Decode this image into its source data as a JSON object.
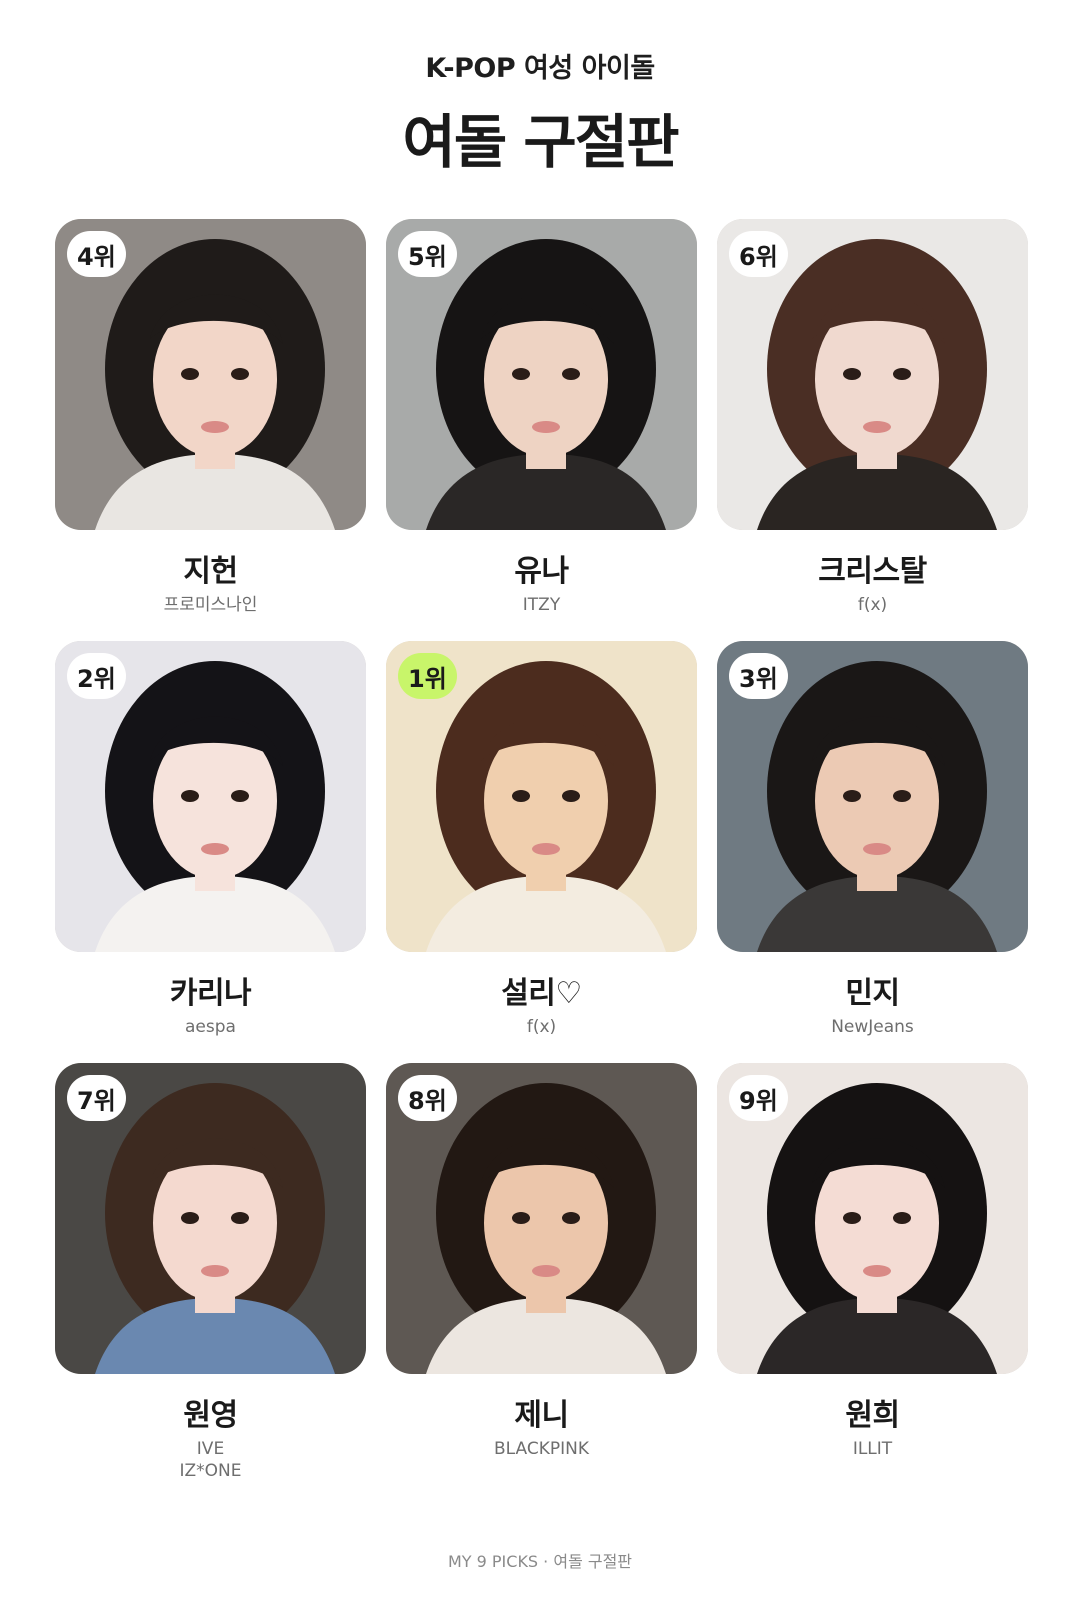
{
  "header": {
    "subtitle": "K-POP 여성 아이돌",
    "title": "여돌 구절판"
  },
  "cards": [
    {
      "rank_label": "4위",
      "name": "지헌",
      "group": "프로미스나인",
      "group_2": "",
      "highlight": false,
      "photo": {
        "bg": "#8f8a86",
        "hair": "#1f1b19",
        "skin": "#f2d6c8",
        "cloth": "#e9e6e2"
      }
    },
    {
      "rank_label": "5위",
      "name": "유나",
      "group": "ITZY",
      "group_2": "",
      "highlight": false,
      "photo": {
        "bg": "#a8aaa9",
        "hair": "#161414",
        "skin": "#eed3c3",
        "cloth": "#2a2726"
      }
    },
    {
      "rank_label": "6위",
      "name": "크리스탈",
      "group": "f(x)",
      "group_2": "",
      "highlight": false,
      "photo": {
        "bg": "#eae8e6",
        "hair": "#4a2e24",
        "skin": "#f0d9cf",
        "cloth": "#2a2522"
      }
    },
    {
      "rank_label": "2위",
      "name": "카리나",
      "group": "aespa",
      "group_2": "",
      "highlight": false,
      "photo": {
        "bg": "#e6e5ea",
        "hair": "#141317",
        "skin": "#f6e3dc",
        "cloth": "#f4f2f0"
      }
    },
    {
      "rank_label": "1위",
      "name": "설리♡",
      "group": "f(x)",
      "group_2": "",
      "highlight": true,
      "photo": {
        "bg": "#efe3c9",
        "hair": "#4c2c1e",
        "skin": "#f0cfae",
        "cloth": "#f3ece0"
      }
    },
    {
      "rank_label": "3위",
      "name": "민지",
      "group": "NewJeans",
      "group_2": "",
      "highlight": false,
      "photo": {
        "bg": "#6f7a82",
        "hair": "#1a1716",
        "skin": "#eccab4",
        "cloth": "#3a3837"
      }
    },
    {
      "rank_label": "7위",
      "name": "원영",
      "group": "IVE",
      "group_2": "IZ*ONE",
      "highlight": false,
      "photo": {
        "bg": "#4a4845",
        "hair": "#3d2a20",
        "skin": "#f4d9cf",
        "cloth": "#6a88b0"
      }
    },
    {
      "rank_label": "8위",
      "name": "제니",
      "group": "BLACKPINK",
      "group_2": "",
      "highlight": false,
      "photo": {
        "bg": "#5e5853",
        "hair": "#221813",
        "skin": "#ecc6ab",
        "cloth": "#ece6e0"
      }
    },
    {
      "rank_label": "9위",
      "name": "원희",
      "group": "ILLIT",
      "group_2": "",
      "highlight": false,
      "photo": {
        "bg": "#ece6e2",
        "hair": "#151212",
        "skin": "#f4dcd4",
        "cloth": "#2b2727"
      }
    }
  ],
  "footer": "MY 9 PICKS · 여돌 구절판"
}
